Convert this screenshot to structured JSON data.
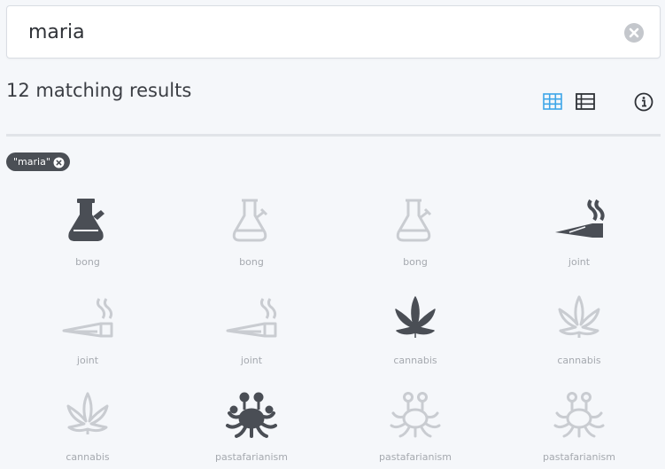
{
  "search": {
    "value": "maria",
    "placeholder": ""
  },
  "results": {
    "heading": "12 matching results"
  },
  "toolbar": {
    "active_view": "grid",
    "accent_color": "#3ea6e8"
  },
  "filter_tag": {
    "label": "\"maria\""
  },
  "icons": [
    {
      "label": "bong",
      "shape": "bong",
      "style": "dark"
    },
    {
      "label": "bong",
      "shape": "bong",
      "style": "light"
    },
    {
      "label": "bong",
      "shape": "bong",
      "style": "light"
    },
    {
      "label": "joint",
      "shape": "joint",
      "style": "dark"
    },
    {
      "label": "joint",
      "shape": "joint",
      "style": "light"
    },
    {
      "label": "joint",
      "shape": "joint",
      "style": "light"
    },
    {
      "label": "cannabis",
      "shape": "cannabis",
      "style": "dark"
    },
    {
      "label": "cannabis",
      "shape": "cannabis",
      "style": "light"
    },
    {
      "label": "cannabis",
      "shape": "cannabis",
      "style": "light"
    },
    {
      "label": "pastafarianism",
      "shape": "pastafarianism",
      "style": "dark"
    },
    {
      "label": "pastafarianism",
      "shape": "pastafarianism",
      "style": "light"
    },
    {
      "label": "pastafarianism",
      "shape": "pastafarianism",
      "style": "light"
    }
  ],
  "colors": {
    "dark_icon": "#4a4e55",
    "light_icon": "#c9ccd1",
    "label": "#a5a9af"
  }
}
